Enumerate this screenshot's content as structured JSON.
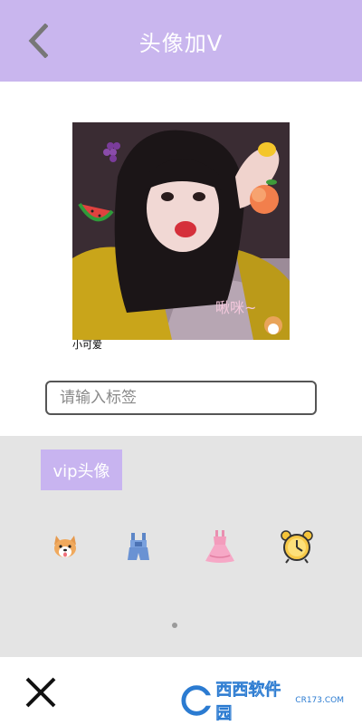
{
  "header": {
    "title": "头像加V",
    "back_icon": "chevron-left-icon",
    "background_color": "#c9b6ee"
  },
  "photo": {
    "caption": "小可爱",
    "overlay_text": "啾咪~",
    "stickers": [
      "grapes",
      "lemon",
      "watermelon",
      "peach",
      "corgi"
    ]
  },
  "tag_input": {
    "placeholder": "请输入标签",
    "value": ""
  },
  "panel": {
    "category_label": "vip头像",
    "stickers": [
      "corgi-sticker",
      "overalls-sticker",
      "dress-sticker",
      "alarm-clock-sticker"
    ],
    "page_indicator": {
      "current": 1,
      "total": 1
    }
  },
  "bottom": {
    "close_icon": "close-icon",
    "watermark": {
      "brand": "西西软件园",
      "url": "CR173.COM"
    }
  },
  "colors": {
    "accent": "#c9b6ee",
    "chip": "#c8b4f0",
    "panel_bg": "#e4e4e4"
  }
}
